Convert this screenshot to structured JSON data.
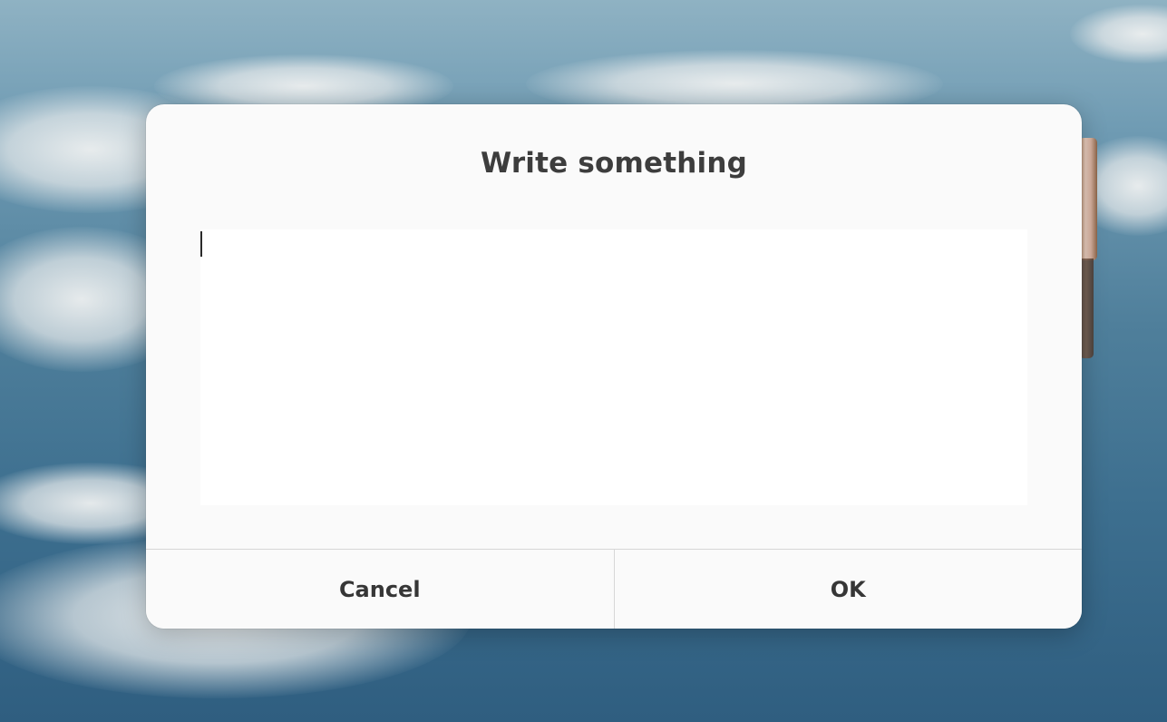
{
  "dialog": {
    "title": "Write something",
    "text_value": "",
    "cancel_label": "Cancel",
    "ok_label": "OK"
  }
}
